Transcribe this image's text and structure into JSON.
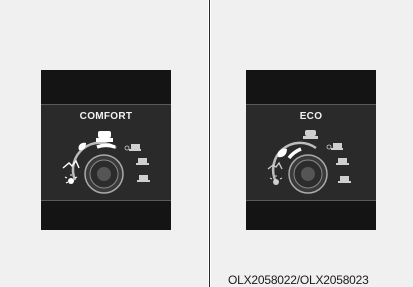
{
  "left_panel": {
    "mode_label": "COMFORT",
    "icons": [
      "leaf-icon",
      "car-front-icon",
      "car-snow-icon",
      "car-incline-icon",
      "mountain-road-icon",
      "car-sand-icon",
      "sun-glare-icon",
      "knob-icon"
    ]
  },
  "right_panel": {
    "mode_label": "ECO",
    "icons": [
      "leaf-icon",
      "car-front-icon",
      "car-snow-icon",
      "car-incline-icon",
      "mountain-road-icon",
      "car-sand-icon",
      "sun-glare-icon",
      "knob-icon"
    ]
  },
  "caption": "OLX2058022/OLX2058023",
  "colors": {
    "panel_background": "#f0f0f0",
    "display_background": "#141414",
    "highlight_band": "#2a2a2a",
    "text": "#f2f2f2"
  }
}
